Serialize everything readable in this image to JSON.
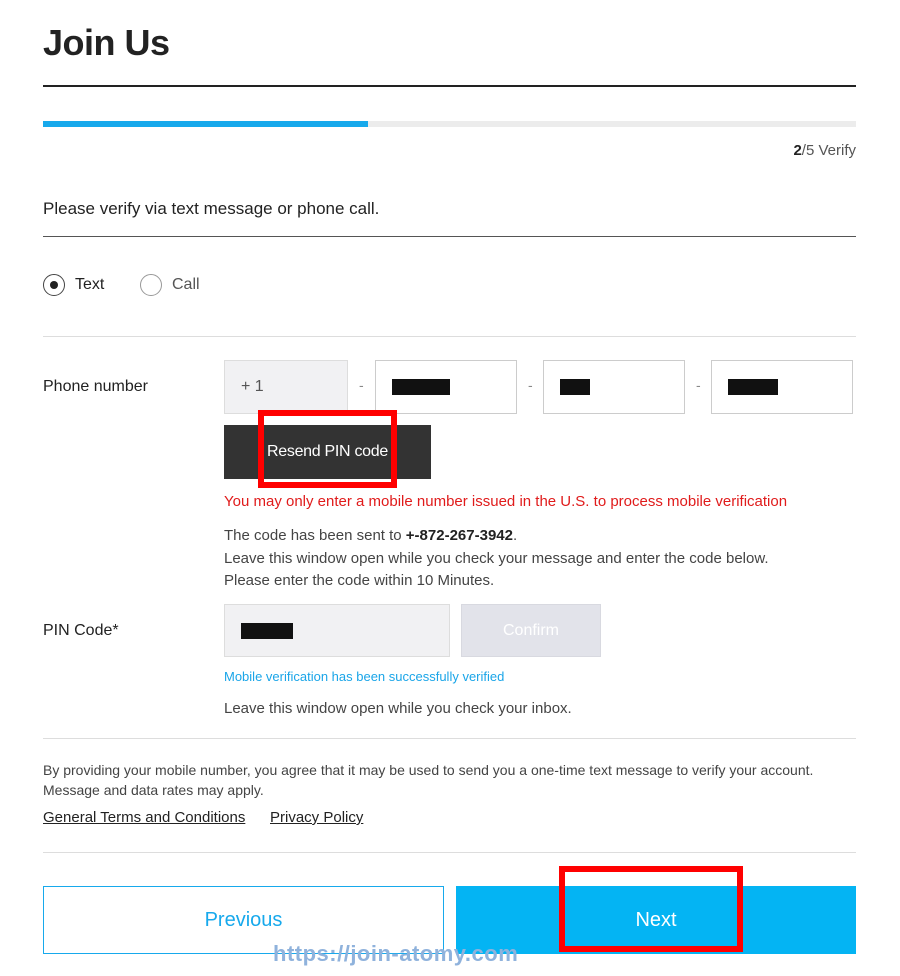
{
  "page": {
    "title": "Join Us",
    "progress": {
      "current": "2",
      "rest": "/5 Verify",
      "fraction": 0.4
    },
    "heading": "Please verify via text message or phone call."
  },
  "method": {
    "options": [
      {
        "label": "Text",
        "selected": true
      },
      {
        "label": "Call",
        "selected": false
      }
    ]
  },
  "phone": {
    "label": "Phone number",
    "country_code": "+ 1",
    "separator": "-",
    "resend_label": "Resend PIN code",
    "warning": "You may only enter a mobile number issued in the U.S. to process mobile verification",
    "sent_prefix": "The code has been sent to ",
    "sent_number": "+-872-267-3942",
    "sent_suffix": ".",
    "keep_open": "Leave this window open while you check your message and enter the code below.",
    "time_limit": "Please enter the code within 10 Minutes."
  },
  "pin": {
    "label": "PIN Code*",
    "confirm_label": "Confirm",
    "success": "Mobile verification has been successfully verified",
    "inbox_note": "Leave this window open while you check your inbox."
  },
  "consent": {
    "text": "By providing your mobile number, you agree that it may be used to send you a one-time text message to verify your account. Message and data rates may apply.",
    "links": [
      "General Terms and Conditions",
      "Privacy Policy"
    ]
  },
  "footer": {
    "previous_label": "Previous",
    "next_label": "Next"
  },
  "watermark": "https://join-atomy.com",
  "colors": {
    "accent": "#17a9ec",
    "next_button": "#04b4f3",
    "warning": "#e01b1b",
    "highlight_box": "#ff0000",
    "resend_button": "#333333"
  },
  "icons": [
    "radio-selected-icon",
    "radio-unselected-icon"
  ]
}
